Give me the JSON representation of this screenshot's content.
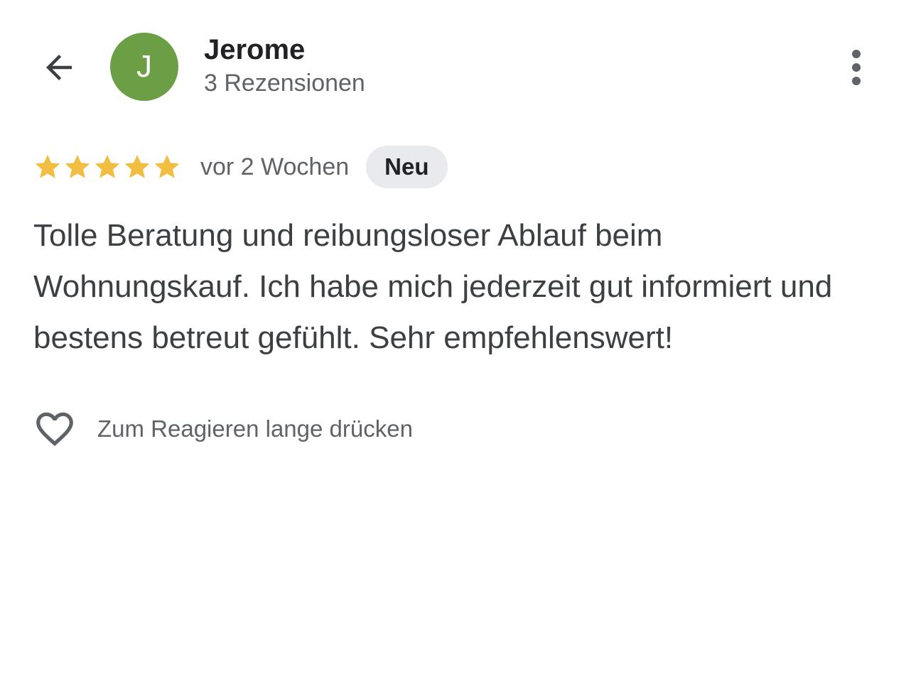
{
  "header": {
    "back_icon": "arrow-left-icon",
    "avatar_initial": "J",
    "avatar_color": "#6b9e45",
    "author_name": "Jerome",
    "review_count": "3 Rezensionen",
    "more_icon": "more-vert-icon"
  },
  "review": {
    "rating": 5,
    "rating_max": 5,
    "star_color": "#f2be42",
    "date": "vor 2 Wochen",
    "badge": "Neu",
    "text": "Tolle Beratung und reibungsloser Ablauf beim Wohnungskauf. Ich habe mich jederzeit gut informiert und bestens betreut gefühlt. Sehr empfehlenswert!"
  },
  "reaction": {
    "icon": "heart-outline-icon",
    "label": "Zum Reagieren lange drücken"
  }
}
